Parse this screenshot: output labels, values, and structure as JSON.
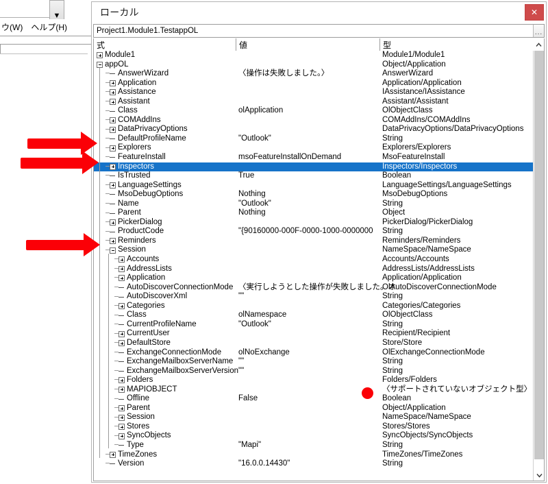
{
  "background_window": {
    "menu_items": [
      "ウ(W)",
      "ヘルプ(H)"
    ],
    "dropdown_icon": "chevron-down-icon"
  },
  "window": {
    "title": "ローカル",
    "close_label": "✕",
    "close_color": "#cf4b4b"
  },
  "pathbar": {
    "value": "Project1.Module1.TestappOL",
    "more_label": "..."
  },
  "columns": {
    "expression": "式",
    "value": "値",
    "type": "型",
    "sort_icon": "chevron-up-icon"
  },
  "scrollbar": {
    "up_icon": "chevron-up-icon",
    "down_icon": "chevron-down-icon"
  },
  "annotations": {
    "arrow_top1": "red-arrow-right",
    "arrow_top2": "red-arrow-right",
    "arrow_bottom": "red-arrow-right",
    "dot": "red-dot"
  },
  "rows": [
    {
      "indent": 0,
      "glyph": "plus",
      "expr": "Module1",
      "value": "",
      "type": "Module1/Module1",
      "selected": false
    },
    {
      "indent": 0,
      "glyph": "minus",
      "expr": "appOL",
      "value": "",
      "type": "Object/Application",
      "selected": false
    },
    {
      "indent": 1,
      "glyph": "dash",
      "expr": "AnswerWizard",
      "value": "〈操作は失敗しました。〉",
      "type": "AnswerWizard",
      "selected": false
    },
    {
      "indent": 1,
      "glyph": "plus",
      "expr": "Application",
      "value": "",
      "type": "Application/Application",
      "selected": false
    },
    {
      "indent": 1,
      "glyph": "plus",
      "expr": "Assistance",
      "value": "",
      "type": "IAssistance/IAssistance",
      "selected": false
    },
    {
      "indent": 1,
      "glyph": "plus",
      "expr": "Assistant",
      "value": "",
      "type": "Assistant/Assistant",
      "selected": false
    },
    {
      "indent": 1,
      "glyph": "dash",
      "expr": "Class",
      "value": "olApplication",
      "type": "OlObjectClass",
      "selected": false
    },
    {
      "indent": 1,
      "glyph": "plus",
      "expr": "COMAddIns",
      "value": "",
      "type": "COMAddIns/COMAddIns",
      "selected": false
    },
    {
      "indent": 1,
      "glyph": "plus",
      "expr": "DataPrivacyOptions",
      "value": "",
      "type": "DataPrivacyOptions/DataPrivacyOptions",
      "selected": false
    },
    {
      "indent": 1,
      "glyph": "dash",
      "expr": "DefaultProfileName",
      "value": "\"Outlook\"",
      "type": "String",
      "selected": false
    },
    {
      "indent": 1,
      "glyph": "plus",
      "expr": "Explorers",
      "value": "",
      "type": "Explorers/Explorers",
      "selected": false
    },
    {
      "indent": 1,
      "glyph": "dash",
      "expr": "FeatureInstall",
      "value": "msoFeatureInstallOnDemand",
      "type": "MsoFeatureInstall",
      "selected": false
    },
    {
      "indent": 1,
      "glyph": "plus",
      "expr": "Inspectors",
      "value": "",
      "type": "Inspectors/Inspectors",
      "selected": true
    },
    {
      "indent": 1,
      "glyph": "dash",
      "expr": "IsTrusted",
      "value": "True",
      "type": "Boolean",
      "selected": false
    },
    {
      "indent": 1,
      "glyph": "plus",
      "expr": "LanguageSettings",
      "value": "",
      "type": "LanguageSettings/LanguageSettings",
      "selected": false
    },
    {
      "indent": 1,
      "glyph": "dash",
      "expr": "MsoDebugOptions",
      "value": "Nothing",
      "type": "MsoDebugOptions",
      "selected": false
    },
    {
      "indent": 1,
      "glyph": "dash",
      "expr": "Name",
      "value": "\"Outlook\"",
      "type": "String",
      "selected": false
    },
    {
      "indent": 1,
      "glyph": "dash",
      "expr": "Parent",
      "value": "Nothing",
      "type": "Object",
      "selected": false
    },
    {
      "indent": 1,
      "glyph": "plus",
      "expr": "PickerDialog",
      "value": "",
      "type": "PickerDialog/PickerDialog",
      "selected": false
    },
    {
      "indent": 1,
      "glyph": "dash",
      "expr": "ProductCode",
      "value": "\"{90160000-000F-0000-1000-0000000",
      "type": "String",
      "selected": false
    },
    {
      "indent": 1,
      "glyph": "plus",
      "expr": "Reminders",
      "value": "",
      "type": "Reminders/Reminders",
      "selected": false
    },
    {
      "indent": 1,
      "glyph": "minus",
      "expr": "Session",
      "value": "",
      "type": "NameSpace/NameSpace",
      "selected": false
    },
    {
      "indent": 2,
      "glyph": "plus",
      "expr": "Accounts",
      "value": "",
      "type": "Accounts/Accounts",
      "selected": false
    },
    {
      "indent": 2,
      "glyph": "plus",
      "expr": "AddressLists",
      "value": "",
      "type": "AddressLists/AddressLists",
      "selected": false
    },
    {
      "indent": 2,
      "glyph": "plus",
      "expr": "Application",
      "value": "",
      "type": "Application/Application",
      "selected": false
    },
    {
      "indent": 2,
      "glyph": "dash",
      "expr": "AutoDiscoverConnectionMode",
      "value": "〈実行しようとした操作が失敗しました。オ",
      "type": "OlAutoDiscoverConnectionMode",
      "selected": false
    },
    {
      "indent": 2,
      "glyph": "dash",
      "expr": "AutoDiscoverXml",
      "value": "\"\"",
      "type": "String",
      "selected": false
    },
    {
      "indent": 2,
      "glyph": "plus",
      "expr": "Categories",
      "value": "",
      "type": "Categories/Categories",
      "selected": false
    },
    {
      "indent": 2,
      "glyph": "dash",
      "expr": "Class",
      "value": "olNamespace",
      "type": "OlObjectClass",
      "selected": false
    },
    {
      "indent": 2,
      "glyph": "dash",
      "expr": "CurrentProfileName",
      "value": "\"Outlook\"",
      "type": "String",
      "selected": false
    },
    {
      "indent": 2,
      "glyph": "plus",
      "expr": "CurrentUser",
      "value": "",
      "type": "Recipient/Recipient",
      "selected": false
    },
    {
      "indent": 2,
      "glyph": "plus",
      "expr": "DefaultStore",
      "value": "",
      "type": "Store/Store",
      "selected": false
    },
    {
      "indent": 2,
      "glyph": "dash",
      "expr": "ExchangeConnectionMode",
      "value": "olNoExchange",
      "type": "OlExchangeConnectionMode",
      "selected": false
    },
    {
      "indent": 2,
      "glyph": "dash",
      "expr": "ExchangeMailboxServerName",
      "value": "\"\"",
      "type": "String",
      "selected": false
    },
    {
      "indent": 2,
      "glyph": "dash",
      "expr": "ExchangeMailboxServerVersion",
      "value": "\"\"",
      "type": "String",
      "selected": false
    },
    {
      "indent": 2,
      "glyph": "plus",
      "expr": "Folders",
      "value": "",
      "type": "Folders/Folders",
      "selected": false
    },
    {
      "indent": 2,
      "glyph": "plus",
      "expr": "MAPIOBJECT",
      "value": "",
      "type": "〈サポートされていないオブジェクト型〉",
      "selected": false
    },
    {
      "indent": 2,
      "glyph": "dash",
      "expr": "Offline",
      "value": "False",
      "type": "Boolean",
      "selected": false
    },
    {
      "indent": 2,
      "glyph": "plus",
      "expr": "Parent",
      "value": "",
      "type": "Object/Application",
      "selected": false
    },
    {
      "indent": 2,
      "glyph": "plus",
      "expr": "Session",
      "value": "",
      "type": "NameSpace/NameSpace",
      "selected": false
    },
    {
      "indent": 2,
      "glyph": "plus",
      "expr": "Stores",
      "value": "",
      "type": "Stores/Stores",
      "selected": false
    },
    {
      "indent": 2,
      "glyph": "plus",
      "expr": "SyncObjects",
      "value": "",
      "type": "SyncObjects/SyncObjects",
      "selected": false
    },
    {
      "indent": 2,
      "glyph": "dash",
      "expr": "Type",
      "value": "\"Mapi\"",
      "type": "String",
      "selected": false
    },
    {
      "indent": 1,
      "glyph": "plus",
      "expr": "TimeZones",
      "value": "",
      "type": "TimeZones/TimeZones",
      "selected": false
    },
    {
      "indent": 1,
      "glyph": "dash",
      "expr": "Version",
      "value": "\"16.0.0.14430\"",
      "type": "String",
      "selected": false
    }
  ]
}
